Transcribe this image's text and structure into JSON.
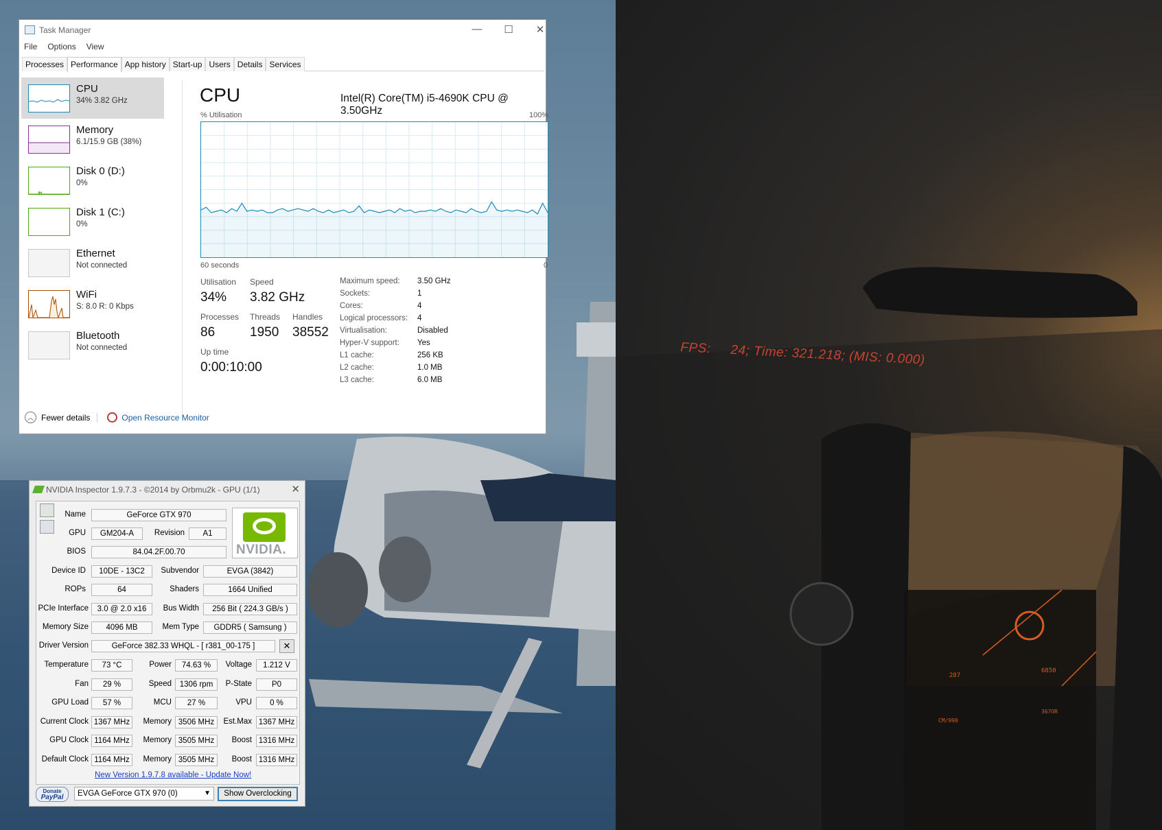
{
  "task_manager": {
    "title": "Task Manager",
    "window_controls": {
      "minimize": "—",
      "maximize": "☐",
      "close": "✕"
    },
    "menu": [
      "File",
      "Options",
      "View"
    ],
    "tabs": [
      "Processes",
      "Performance",
      "App history",
      "Start-up",
      "Users",
      "Details",
      "Services"
    ],
    "active_tab": "Performance",
    "sidebar": [
      {
        "name": "CPU",
        "sub": "34% 3.82 GHz",
        "color": "#1a8bb9"
      },
      {
        "name": "Memory",
        "sub": "6.1/15.9 GB (38%)",
        "color": "#8b2c9c"
      },
      {
        "name": "Disk 0 (D:)",
        "sub": "0%",
        "color": "#4da60c"
      },
      {
        "name": "Disk 1 (C:)",
        "sub": "0%",
        "color": "#4da60c"
      },
      {
        "name": "Ethernet",
        "sub": "Not connected",
        "color": "#a74f01"
      },
      {
        "name": "WiFi",
        "sub_prefix_s": "S:",
        "sub_s": "8.0",
        "sub_prefix_r": "R:",
        "sub_r": "0 Kbps",
        "color": "#a74f01"
      },
      {
        "name": "Bluetooth",
        "sub": "Not connected",
        "color": "#a74f01"
      }
    ],
    "cpu": {
      "title": "CPU",
      "model": "Intel(R) Core(TM) i5-4690K CPU @ 3.50GHz",
      "graph_label": "% Utilisation",
      "graph_max": "100%",
      "graph_span": "60 seconds",
      "graph_min": "0",
      "stats": {
        "utilisation_label": "Utilisation",
        "utilisation": "34%",
        "speed_label": "Speed",
        "speed": "3.82 GHz",
        "processes_label": "Processes",
        "processes": "86",
        "threads_label": "Threads",
        "threads": "1950",
        "handles_label": "Handles",
        "handles": "38552",
        "uptime_label": "Up time",
        "uptime": "0:00:10:00"
      },
      "specs": [
        {
          "label": "Maximum speed:",
          "value": "3.50 GHz"
        },
        {
          "label": "Sockets:",
          "value": "1"
        },
        {
          "label": "Cores:",
          "value": "4"
        },
        {
          "label": "Logical processors:",
          "value": "4"
        },
        {
          "label": "Virtualisation:",
          "value": "Disabled"
        },
        {
          "label": "Hyper-V support:",
          "value": "Yes"
        },
        {
          "label": "L1 cache:",
          "value": "256 KB"
        },
        {
          "label": "L2 cache:",
          "value": "1.0 MB"
        },
        {
          "label": "L3 cache:",
          "value": "6.0 MB"
        }
      ],
      "utilisation_history": [
        35,
        37,
        33,
        34,
        35,
        33,
        36,
        34,
        40,
        34,
        35,
        34,
        35,
        33,
        33,
        35,
        36,
        34,
        35,
        36,
        35,
        34,
        36,
        34,
        33,
        35,
        33,
        34,
        35,
        33,
        34,
        38,
        33,
        35,
        34,
        33,
        34,
        35,
        33,
        36,
        34,
        35,
        33,
        34,
        34,
        35,
        34,
        36,
        34,
        33,
        35,
        34,
        33,
        36,
        34,
        33,
        34,
        41,
        35,
        34,
        35,
        34,
        35,
        34,
        33,
        35,
        32,
        40,
        33
      ]
    },
    "footer": {
      "fewer_details": "Fewer details",
      "open_resource_monitor": "Open Resource Monitor"
    }
  },
  "nvidia": {
    "title": "NVIDIA Inspector 1.9.7.3 - ©2014 by Orbmu2k - GPU (1/1)",
    "close": "✕",
    "logo_text": "NVIDIA.",
    "labels": {
      "name": "Name",
      "gpu": "GPU",
      "revision": "Revision",
      "bios": "BIOS",
      "device_id": "Device ID",
      "subvendor": "Subvendor",
      "rops": "ROPs",
      "shaders": "Shaders",
      "pcie": "PCIe Interface",
      "bus_width": "Bus Width",
      "memory_size": "Memory Size",
      "mem_type": "Mem Type",
      "driver": "Driver Version",
      "temperature": "Temperature",
      "power": "Power",
      "voltage": "Voltage",
      "fan": "Fan",
      "speed": "Speed",
      "pstate": "P-State",
      "gpu_load": "GPU Load",
      "mcu": "MCU",
      "vpu": "VPU",
      "current_clock": "Current Clock",
      "memory": "Memory",
      "est_max": "Est.Max",
      "gpu_clock": "GPU Clock",
      "boost": "Boost",
      "default_clock": "Default Clock"
    },
    "values": {
      "name": "GeForce GTX 970",
      "gpu": "GM204-A",
      "revision": "A1",
      "bios": "84.04.2F.00.70",
      "device_id": "10DE - 13C2",
      "subvendor": "EVGA (3842)",
      "rops": "64",
      "shaders": "1664 Unified",
      "pcie": "3.0 @ 2.0 x16",
      "bus_width": "256 Bit ( 224.3 GB/s )",
      "memory_size": "4096 MB",
      "mem_type": "GDDR5 ( Samsung )",
      "driver": "GeForce 382.33 WHQL - [ r381_00-175 ]",
      "temperature": "73 °C",
      "power": "74.63 %",
      "voltage": "1.212 V",
      "fan": "29 %",
      "speed": "1306 rpm",
      "pstate": "P0",
      "gpu_load": "57 %",
      "mcu": "27 %",
      "vpu": "0 %",
      "current_clock": "1367 MHz",
      "current_mem": "3506 MHz",
      "est_max": "1367 MHz",
      "gpu_clock": "1164 MHz",
      "gpu_mem": "3505 MHz",
      "gpu_boost": "1316 MHz",
      "default_clock": "1164 MHz",
      "default_mem": "3505 MHz",
      "default_boost": "1316 MHz"
    },
    "update_link": "New Version 1.9.7.8 available - Update Now!",
    "donate_top": "Donate",
    "donate_bottom": "PayPal",
    "gpu_select": "EVGA GeForce GTX 970 (0)",
    "show_oc_button": "Show Overclocking",
    "tool_icon": "✕"
  },
  "game_overlay": {
    "fps_label": "FPS:",
    "fps_value": "24; Time: 321.218; (MIS: 0.000)",
    "color": "#c8442f"
  }
}
